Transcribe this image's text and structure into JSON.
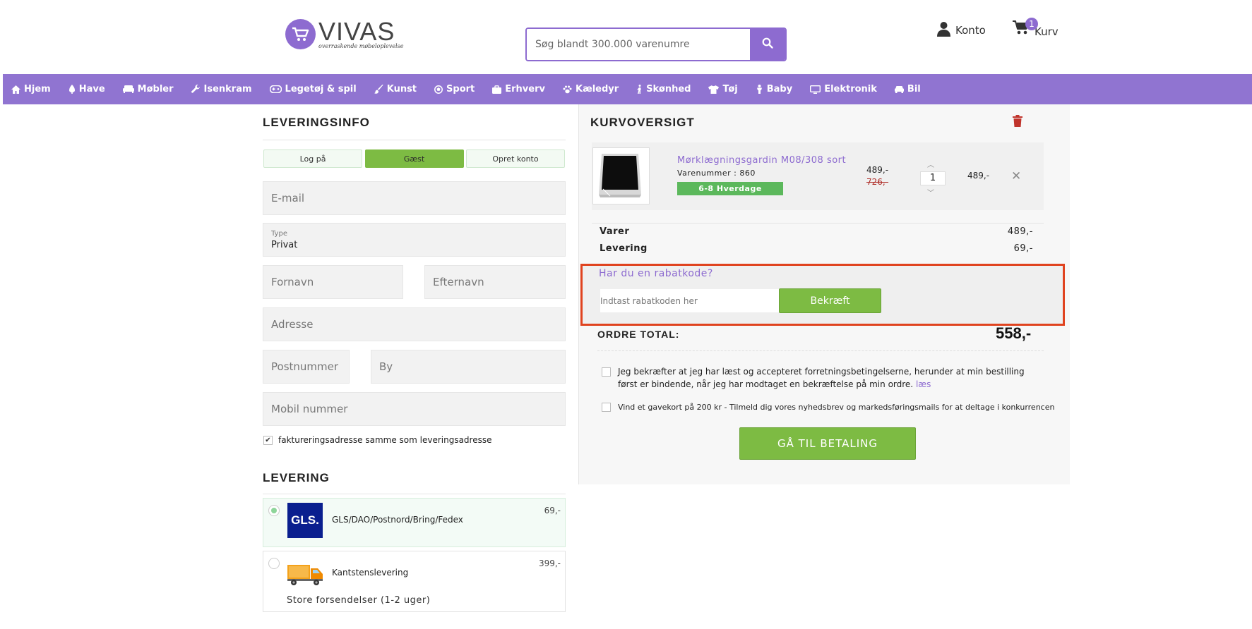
{
  "header": {
    "logo_name": "VIVAS",
    "logo_tagline": "overraskende møbeloplevelse",
    "search_placeholder": "Søg blandt 300.000 varenumre",
    "account_label": "Konto",
    "cart_label": "Kurv",
    "cart_count": "1"
  },
  "nav": {
    "items": [
      {
        "label": "Hjem",
        "icon": "home-icon"
      },
      {
        "label": "Have",
        "icon": "tree-icon"
      },
      {
        "label": "Møbler",
        "icon": "sofa-icon"
      },
      {
        "label": "Isenkram",
        "icon": "wrench-icon"
      },
      {
        "label": "Legetøj & spil",
        "icon": "gamepad-icon"
      },
      {
        "label": "Kunst",
        "icon": "brush-icon"
      },
      {
        "label": "Sport",
        "icon": "ball-icon"
      },
      {
        "label": "Erhverv",
        "icon": "briefcase-icon"
      },
      {
        "label": "Kæledyr",
        "icon": "paw-icon"
      },
      {
        "label": "Skønhed",
        "icon": "figure-icon"
      },
      {
        "label": "Tøj",
        "icon": "shirt-icon"
      },
      {
        "label": "Baby",
        "icon": "baby-icon"
      },
      {
        "label": "Elektronik",
        "icon": "monitor-icon"
      },
      {
        "label": "Bil",
        "icon": "car-icon"
      }
    ]
  },
  "delivery_info": {
    "title": "LEVERINGSINFO",
    "tabs": [
      {
        "label": "Log på",
        "active": false
      },
      {
        "label": "Gæst",
        "active": true
      },
      {
        "label": "Opret konto",
        "active": false
      }
    ],
    "email_placeholder": "E-mail",
    "type_label": "Type",
    "type_value": "Privat",
    "firstname_placeholder": "Fornavn",
    "lastname_placeholder": "Efternavn",
    "address_placeholder": "Adresse",
    "zip_placeholder": "Postnummer",
    "city_placeholder": "By",
    "mobile_placeholder": "Mobil nummer",
    "billing_same_label": "faktureringsadresse samme som leveringsadresse",
    "billing_same_checked": true
  },
  "shipping": {
    "title": "LEVERING",
    "options": [
      {
        "name": "GLS/DAO/Postnord/Bring/Fedex",
        "price": "69,-",
        "selected": true,
        "logo_text": "GLS."
      },
      {
        "name": "Kantstenslevering",
        "price": "399,-",
        "selected": false,
        "note": "Store forsendelser (1-2 uger)"
      }
    ]
  },
  "cart": {
    "title": "KURVOVERSIGT",
    "item": {
      "title": "Mørklægningsgardin M08/308 sort",
      "sku": "Varenummer : 860",
      "badge": "6-8 Hverdage",
      "price": "489,-",
      "old_price": "726,-",
      "quantity": "1",
      "line_total": "489,-"
    },
    "summary": [
      {
        "label": "Varer",
        "value": "489,-"
      },
      {
        "label": "Levering",
        "value": "69,-"
      }
    ],
    "discount": {
      "title": "Har du en rabatkode?",
      "placeholder": "Indtast rabatkoden her",
      "button": "Bekræft"
    },
    "total_label": "ORDRE TOTAL:",
    "total_value": "558,-",
    "terms_text": "Jeg bekræfter at jeg har læst og accepteret forretningsbetingelserne, herunder at min bestilling først er bindende, når jeg har modtaget en bekræftelse på min ordre.",
    "terms_link": "læs",
    "newsletter_text": "Vind et gavekort på 200 kr - Tilmeld dig vores nyhedsbrev og markedsføringsmails for at deltage i konkurrencen",
    "pay_button": "GÅ TIL BETALING"
  },
  "colors": {
    "brand": "#8d6bd0",
    "nav": "#9074d1",
    "green": "#7dbb43",
    "highlight": "#e0431f"
  }
}
